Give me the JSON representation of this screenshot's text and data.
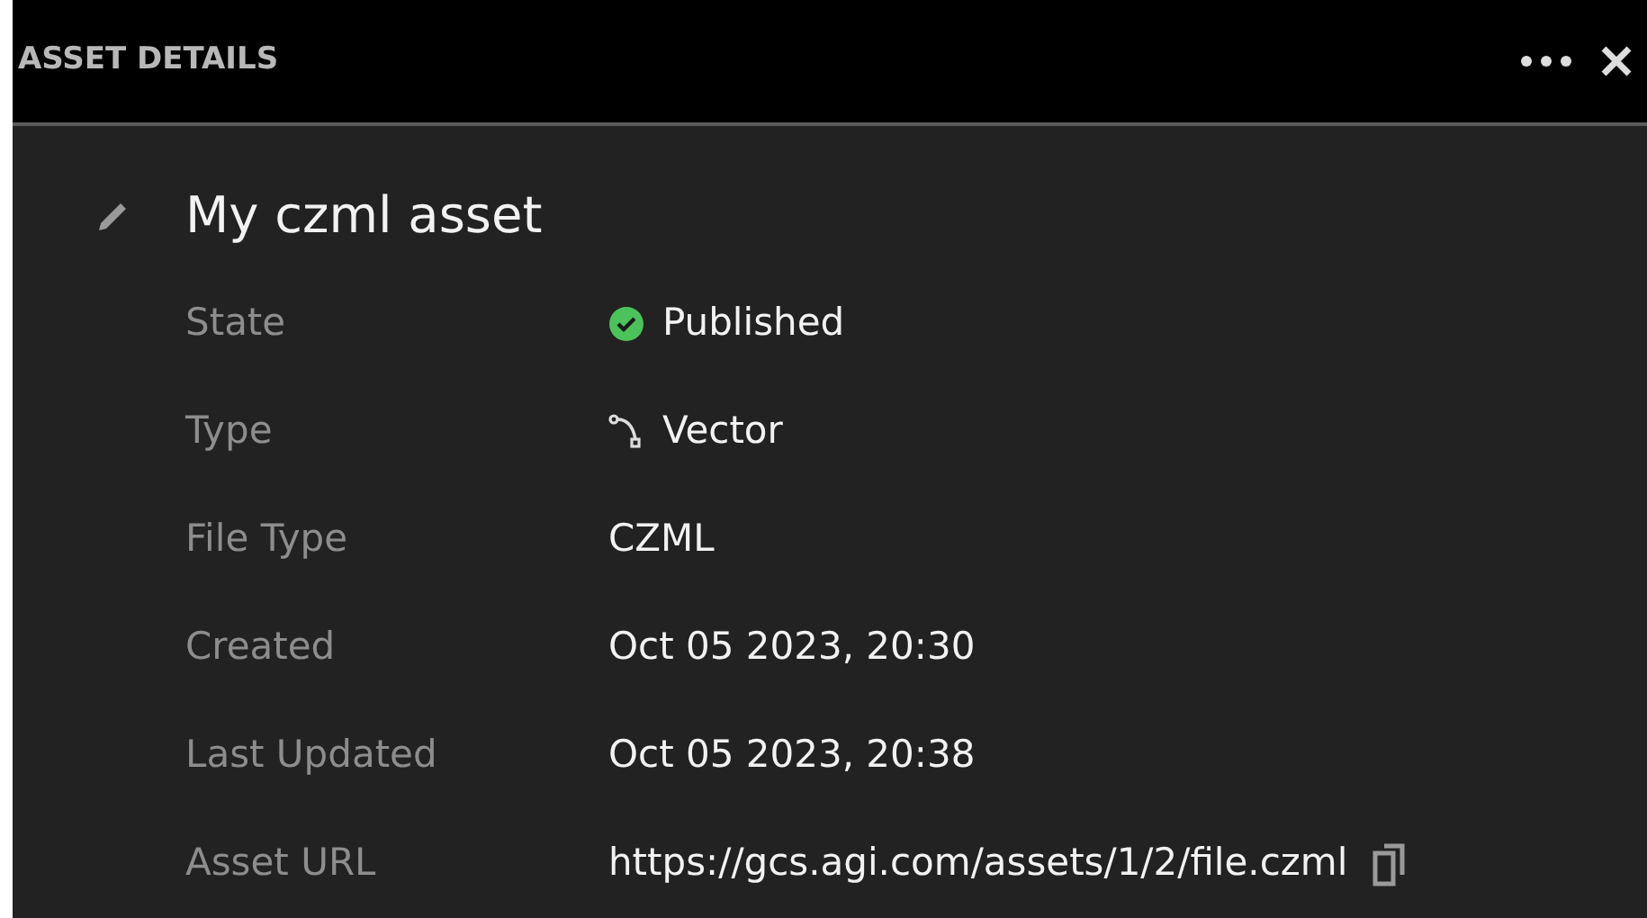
{
  "panel": {
    "title": "ASSET DETAILS"
  },
  "asset": {
    "name": "My czml asset"
  },
  "fields": [
    {
      "kind": "status",
      "label": "State",
      "value": "Published"
    },
    {
      "kind": "type",
      "label": "Type",
      "value": "Vector"
    },
    {
      "kind": "text",
      "label": "File Type",
      "value": "CZML"
    },
    {
      "kind": "text",
      "label": "Created",
      "value": "Oct 05 2023, 20:30"
    },
    {
      "kind": "text",
      "label": "Last Updated",
      "value": "Oct 05 2023, 20:38"
    },
    {
      "kind": "url",
      "label": "Asset URL",
      "value": "https://gcs.agi.com/assets/1/2/file.czml"
    }
  ]
}
